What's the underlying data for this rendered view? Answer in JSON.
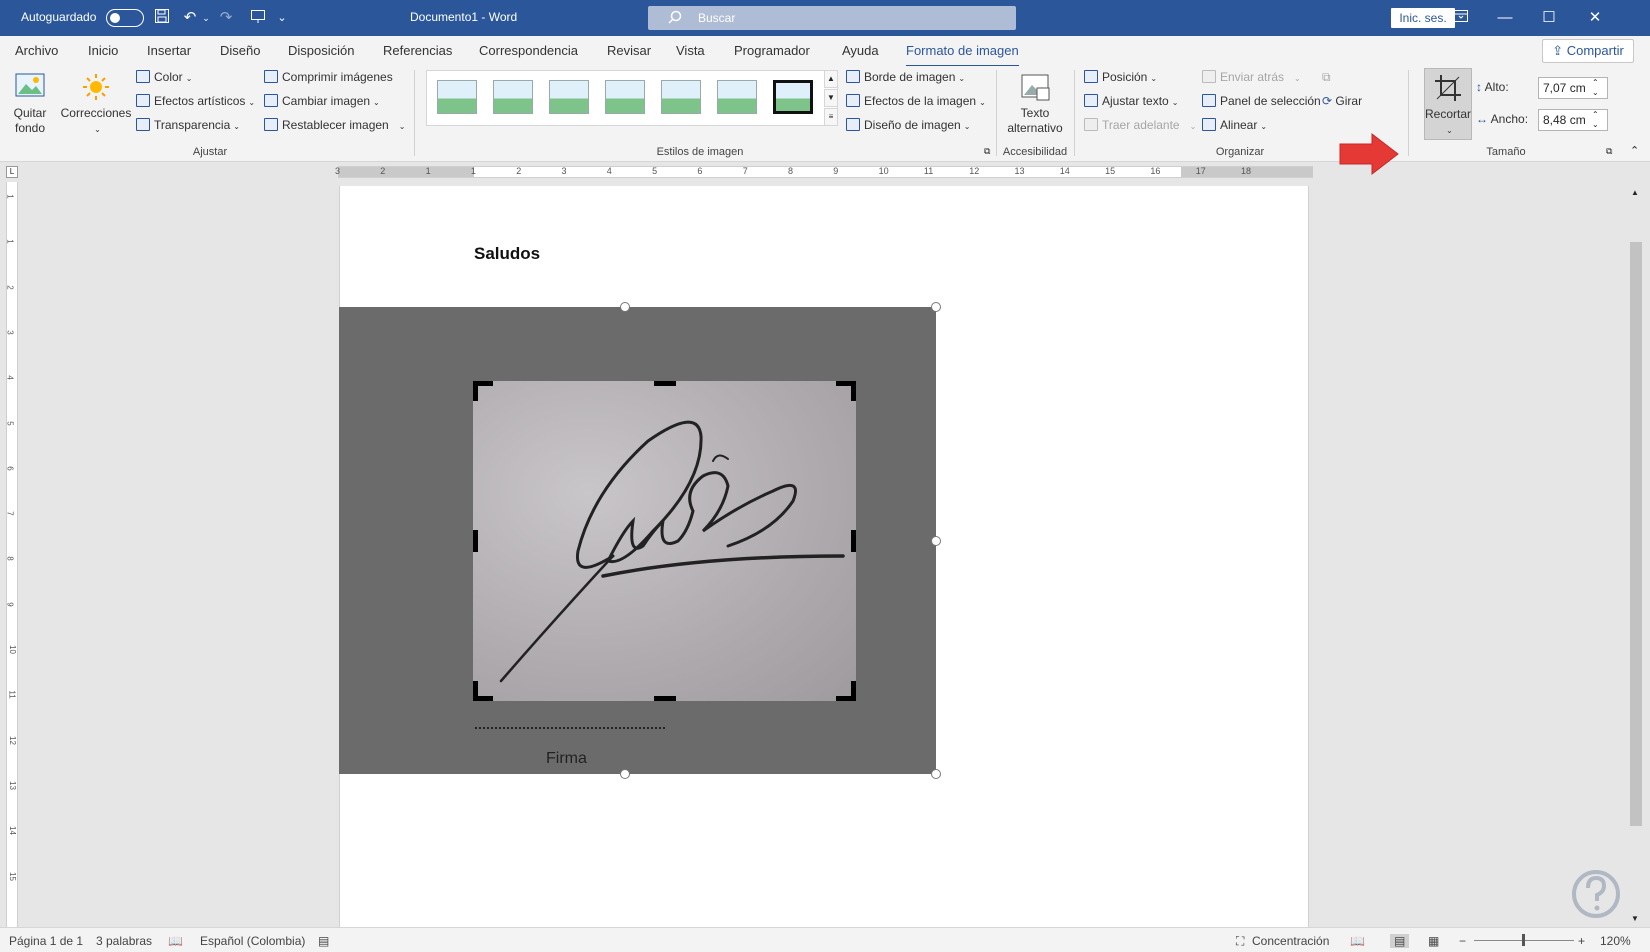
{
  "titlebar": {
    "autosave_label": "Autoguardado",
    "doc_title": "Documento1 - Word",
    "search_placeholder": "Buscar",
    "signin_label": "Inic. ses."
  },
  "tabs": [
    "Archivo",
    "Inicio",
    "Insertar",
    "Diseño",
    "Disposición",
    "Referencias",
    "Correspondencia",
    "Revisar",
    "Vista",
    "Programador",
    "Ayuda",
    "Formato de imagen"
  ],
  "active_tab": "Formato de imagen",
  "share_label": "Compartir",
  "ribbon": {
    "ajustar": {
      "quitar_fondo_1": "Quitar",
      "quitar_fondo_2": "fondo",
      "correcciones": "Correcciones",
      "color": "Color",
      "efectos_artisticos": "Efectos artísticos",
      "transparencia": "Transparencia",
      "comprimir": "Comprimir imágenes",
      "cambiar": "Cambiar imagen",
      "restablecer": "Restablecer imagen",
      "group_label": "Ajustar"
    },
    "estilos": {
      "borde": "Borde de imagen",
      "efectos": "Efectos de la imagen",
      "diseno": "Diseño de imagen",
      "group_label": "Estilos de imagen"
    },
    "accesibilidad": {
      "texto_1": "Texto",
      "texto_2": "alternativo",
      "group_label": "Accesibilidad"
    },
    "organizar": {
      "posicion": "Posición",
      "ajustar_texto": "Ajustar texto",
      "traer_adelante": "Traer adelante",
      "enviar_atras": "Enviar atrás",
      "panel_seleccion": "Panel de selección",
      "alinear": "Alinear",
      "girar": "Girar",
      "group_label": "Organizar"
    },
    "tamano": {
      "recortar": "Recortar",
      "alto_label": "Alto:",
      "alto_value": "7,07 cm",
      "ancho_label": "Ancho:",
      "ancho_value": "8,48 cm",
      "group_label": "Tamaño"
    }
  },
  "ruler_h": [
    "3",
    "2",
    "1",
    "1",
    "2",
    "3",
    "4",
    "5",
    "6",
    "7",
    "8",
    "9",
    "10",
    "11",
    "12",
    "13",
    "14",
    "15",
    "16",
    "17",
    "18"
  ],
  "ruler_v": [
    "1",
    "1",
    "2",
    "3",
    "4",
    "5",
    "6",
    "7",
    "8",
    "9",
    "10",
    "11",
    "12",
    "13",
    "14",
    "15"
  ],
  "document": {
    "heading": "Saludos",
    "caption": "Firma"
  },
  "status": {
    "page": "Página 1 de 1",
    "words": "3 palabras",
    "language": "Español (Colombia)",
    "focus": "Concentración",
    "zoom": "120%"
  },
  "colors": {
    "brand": "#2b579a",
    "annotation_arrow": "#e53935"
  }
}
